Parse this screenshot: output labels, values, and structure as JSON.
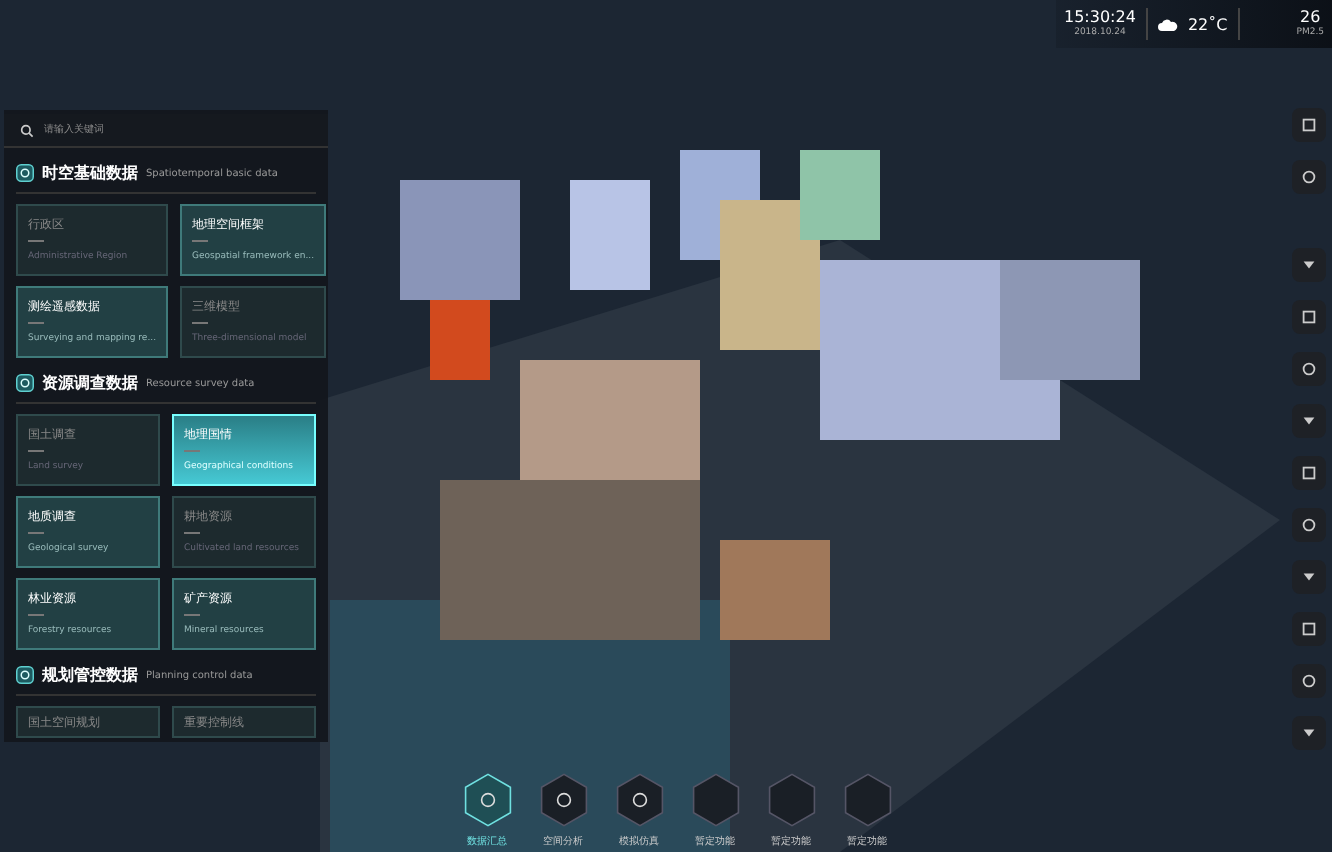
{
  "search": {
    "placeholder": "请输入关键词"
  },
  "sections": [
    {
      "title": "时空基础数据",
      "subtitle": "Spatiotemporal basic data",
      "cards": [
        {
          "title": "行政区",
          "desc": "Administrative Region",
          "enabled": false,
          "selected": false
        },
        {
          "title": "地理空间框架",
          "desc": "Geospatial framework en...",
          "enabled": true,
          "selected": false
        },
        {
          "title": "测绘遥感数据",
          "desc": "Surveying and mapping re...",
          "enabled": true,
          "selected": false
        },
        {
          "title": "三维模型",
          "desc": "Three-dimensional model",
          "enabled": false,
          "selected": false
        }
      ]
    },
    {
      "title": "资源调查数据",
      "subtitle": "Resource survey data",
      "cards": [
        {
          "title": "国土调查",
          "desc": "Land survey",
          "enabled": false,
          "selected": false
        },
        {
          "title": "地理国情",
          "desc": "Geographical conditions",
          "enabled": true,
          "selected": true
        },
        {
          "title": "地质调查",
          "desc": "Geological survey",
          "enabled": true,
          "selected": false
        },
        {
          "title": "耕地资源",
          "desc": "Cultivated land resources",
          "enabled": false,
          "selected": false
        },
        {
          "title": "林业资源",
          "desc": "Forestry resources",
          "enabled": true,
          "selected": false
        },
        {
          "title": "矿产资源",
          "desc": "Mineral resources",
          "enabled": true,
          "selected": false
        }
      ]
    },
    {
      "title": "规划管控数据",
      "subtitle": "Planning control data",
      "cards": [
        {
          "title": "国土空间规划",
          "enabled": false,
          "selected": false
        },
        {
          "title": "重要控制线",
          "enabled": false,
          "selected": false
        }
      ]
    }
  ],
  "status": {
    "time": "15:30:24",
    "date": "2018.10.24",
    "temperature": "22˚C",
    "aqi": "26",
    "aqi_label": "PM2.5"
  },
  "bottom_nav": [
    {
      "label": "数据汇总",
      "selected": true
    },
    {
      "label": "空间分析",
      "selected": false
    },
    {
      "label": "模拟仿真",
      "selected": false
    },
    {
      "label": "暂定功能",
      "selected": false
    },
    {
      "label": "暂定功能",
      "selected": false
    },
    {
      "label": "暂定功能",
      "selected": false
    }
  ]
}
